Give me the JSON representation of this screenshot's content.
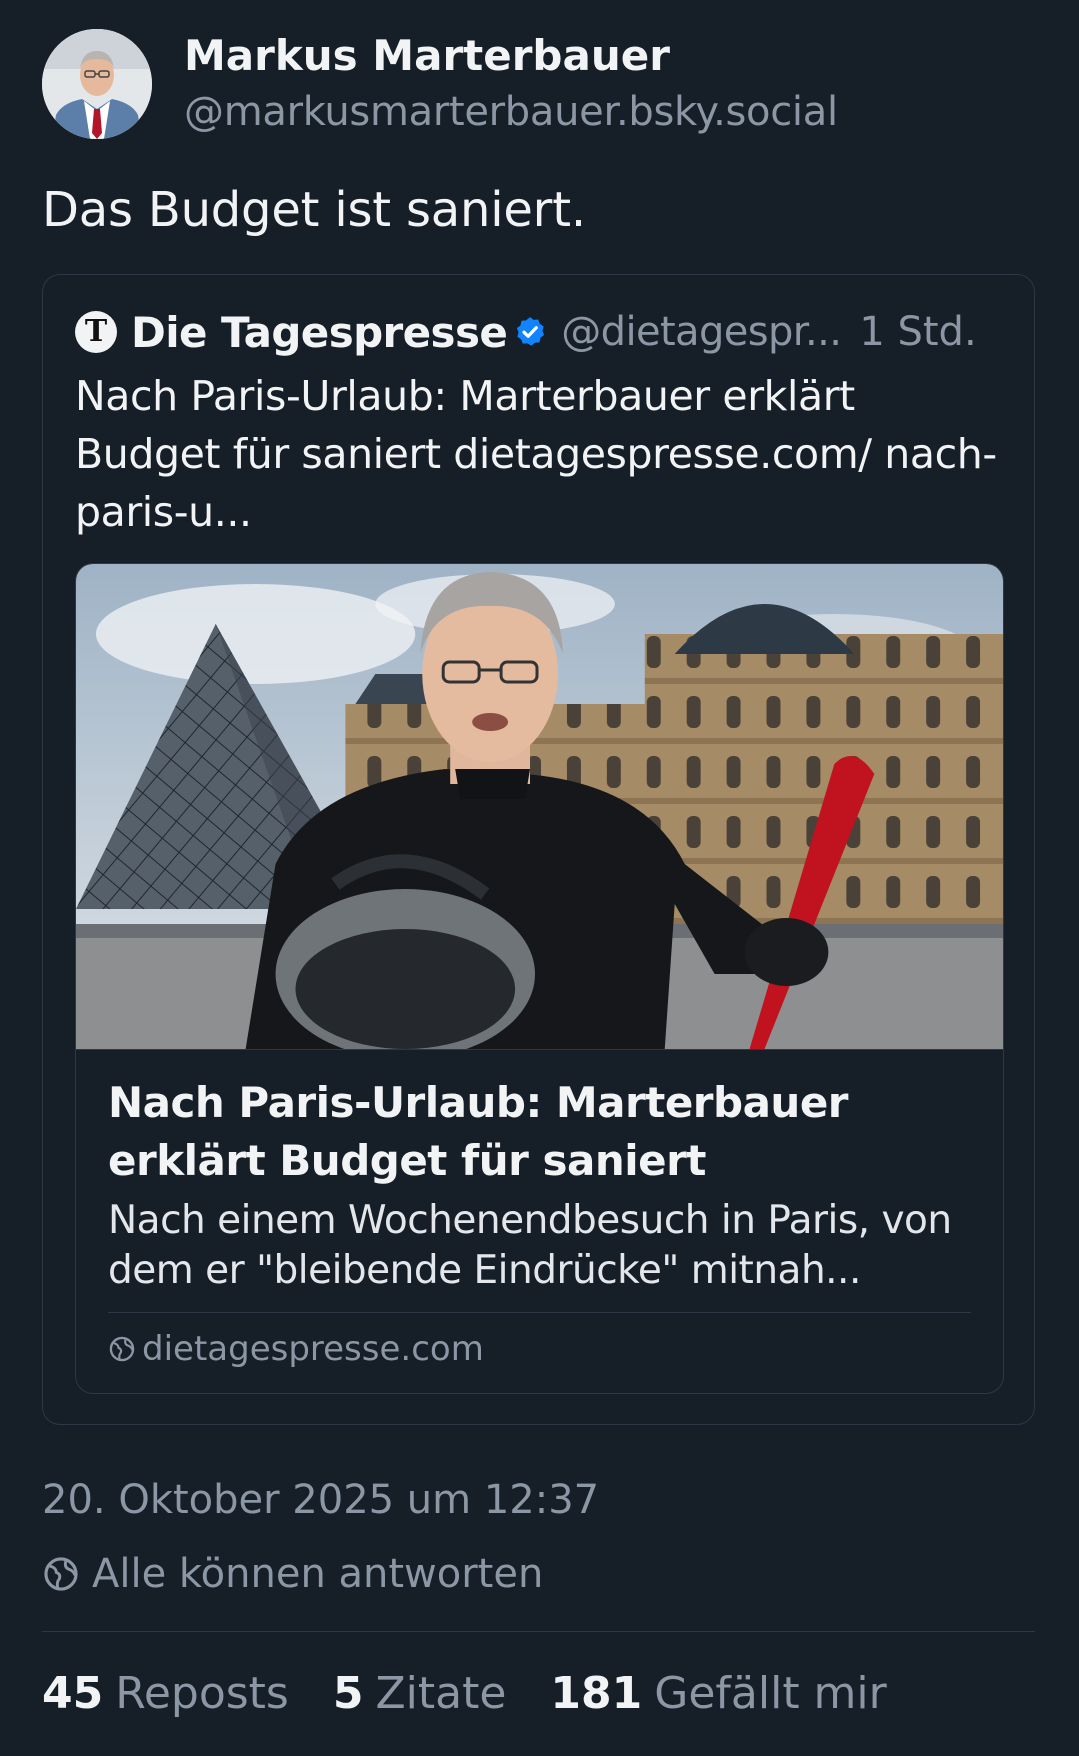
{
  "author": {
    "display_name": "Markus Marterbauer",
    "handle": "@markusmarterbauer.bsky.social",
    "avatar_icon": "profile-photo"
  },
  "post": {
    "text": "Das Budget ist saniert."
  },
  "quote": {
    "avatar_letter": "T",
    "display_name": "Die Tagespresse",
    "verified_icon": "verified-check-icon",
    "handle": "@dietagespr...",
    "time": "1 Std.",
    "text": "Nach Paris-Urlaub: Marterbauer erklärt Budget für saniert dietagespresse.com/ nach-paris-u...",
    "link_card": {
      "title": "Nach Paris-Urlaub: Marterbauer erklärt Budget für saniert",
      "description": "Nach einem Wochenendbesuch in Paris, von dem er \"bleibende Eindrücke\" mitnah...",
      "domain": "dietagespresse.com",
      "domain_icon": "globe-icon"
    }
  },
  "meta": {
    "timestamp": "20. Oktober 2025 um 12:37",
    "reply_setting": "Alle können antworten",
    "reply_icon": "globe-icon"
  },
  "stats": {
    "reposts_count": "45",
    "reposts_label": "Reposts",
    "quotes_count": "5",
    "quotes_label": "Zitate",
    "likes_count": "181",
    "likes_label": "Gefällt mir"
  },
  "colors": {
    "background": "#161e27",
    "text": "#f1f3f5",
    "muted": "#8b97a5",
    "border": "#2c3845",
    "verified": "#1083fe"
  }
}
